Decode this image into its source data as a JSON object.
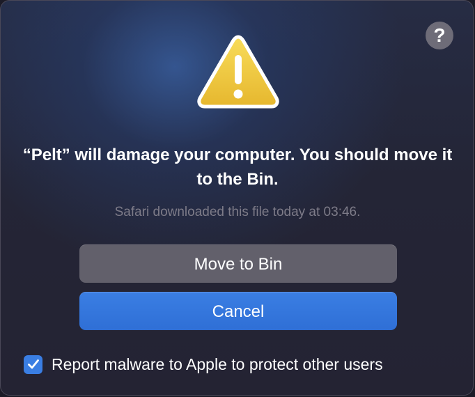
{
  "dialog": {
    "help_label": "?",
    "title": "“Pelt” will damage your computer. You should move it to the Bin.",
    "subtitle": "Safari downloaded this file today at 03:46.",
    "warning_icon": "warning-triangle-icon",
    "buttons": {
      "move_label": "Move to Bin",
      "cancel_label": "Cancel"
    },
    "report": {
      "label": "Report malware to Apple to protect other users",
      "checked": true
    }
  },
  "colors": {
    "accent": "#3a7ee3",
    "warning": "#f0c53c",
    "secondary_button": "#62606b",
    "background": "#242333"
  }
}
